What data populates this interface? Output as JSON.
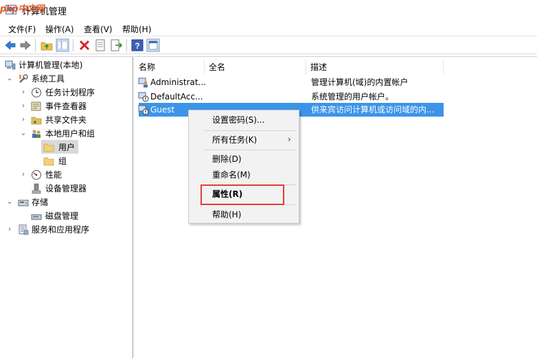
{
  "window": {
    "title": "计算机管理",
    "watermark": "php中文网"
  },
  "menu": [
    "文件(F)",
    "操作(A)",
    "查看(V)",
    "帮助(H)"
  ],
  "toolbar": [
    "back-icon",
    "forward-icon",
    "up-folder-icon",
    "show-tree-icon",
    "delete-icon",
    "properties-sheet-icon",
    "export-icon",
    "help-icon",
    "view-icon"
  ],
  "tree": [
    {
      "label": "计算机管理(本地)",
      "icon": "computer-icon"
    },
    {
      "label": "系统工具",
      "icon": "tools-icon"
    },
    {
      "label": "任务计划程序",
      "icon": "clock-icon"
    },
    {
      "label": "事件查看器",
      "icon": "event-viewer-icon"
    },
    {
      "label": "共享文件夹",
      "icon": "shared-folder-icon"
    },
    {
      "label": "本地用户和组",
      "icon": "users-group-icon"
    },
    {
      "label": "用户",
      "icon": "folder-icon"
    },
    {
      "label": "组",
      "icon": "folder-icon"
    },
    {
      "label": "性能",
      "icon": "performance-icon"
    },
    {
      "label": "设备管理器",
      "icon": "device-manager-icon"
    },
    {
      "label": "存储",
      "icon": "storage-icon"
    },
    {
      "label": "磁盘管理",
      "icon": "disk-icon"
    },
    {
      "label": "服务和应用程序",
      "icon": "services-icon"
    }
  ],
  "columns": [
    "名称",
    "全名",
    "描述"
  ],
  "rows": [
    {
      "name": "Administrat...",
      "fullname": "",
      "desc": "管理计算机(域)的内置帐户"
    },
    {
      "name": "DefaultAcc...",
      "fullname": "",
      "desc": "系统管理的用户帐户。"
    },
    {
      "name": "Guest",
      "fullname": "",
      "desc": "供来宾访问计算机或访问域的内..."
    }
  ],
  "context_menu": {
    "set_password": "设置密码(S)...",
    "all_tasks": "所有任务(K)",
    "delete": "删除(D)",
    "rename": "重命名(M)",
    "properties": "属性(R)",
    "help": "帮助(H)"
  },
  "colors": {
    "selection": "#3c94e8",
    "highlight_box": "#e53935"
  }
}
